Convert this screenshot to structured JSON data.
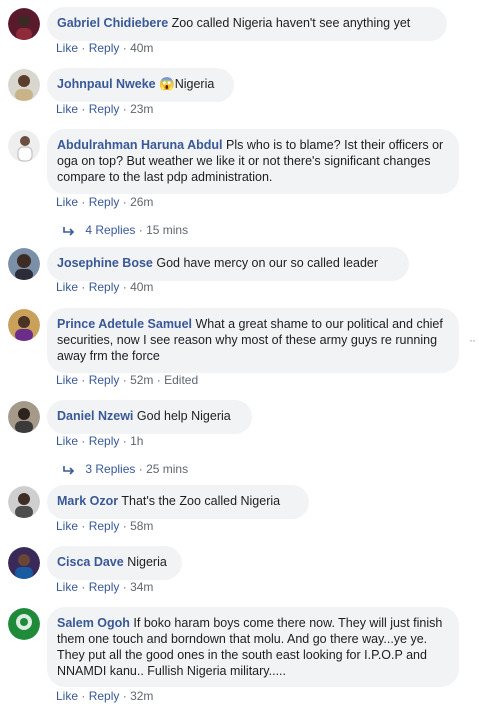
{
  "ui": {
    "like": "Like",
    "reply": "Reply",
    "dot": "·"
  },
  "comments": [
    {
      "name": "Gabriel Chidiebere",
      "text": "Zoo called Nigeria haven't see anything yet",
      "time": "40m"
    },
    {
      "name": "Johnpaul Nweke",
      "emoji": "😱",
      "text": "Nigeria",
      "time": "23m"
    },
    {
      "name": "Abdulrahman Haruna Abdul",
      "text": "Pls who is to blame? Ist their officers or oga on top? But weather we like it or not there's significant changes compare to the last pdp administration.",
      "time": "26m",
      "replies": {
        "label": "4 Replies",
        "time": "15 mins"
      }
    },
    {
      "name": "Josephine Bose",
      "text": "God have mercy on our so called leader",
      "time": "40m"
    },
    {
      "name": "Prince Adetule Samuel",
      "text": "What a great shame to our political and chief securities, now I see reason why most of these army guys re running away frm the force",
      "time": "52m",
      "edited": "Edited"
    },
    {
      "name": "Daniel Nzewi",
      "text": "God help Nigeria",
      "time": "1h",
      "replies": {
        "label": "3 Replies",
        "time": "25 mins"
      }
    },
    {
      "name": "Mark Ozor",
      "text": "That's the Zoo called Nigeria",
      "time": "58m"
    },
    {
      "name": "Cisca Dave",
      "text": "Nigeria",
      "time": "34m"
    },
    {
      "name": "Salem Ogoh",
      "text": "If boko haram boys come there now. They will just finish them one touch and borndown that molu. And go there way...ye ye. They put all the good ones in the south east looking for I.P.O.P and NNAMDI kanu.. Fullish Nigeria military.....",
      "time": "32m"
    }
  ],
  "more_dots": "··"
}
